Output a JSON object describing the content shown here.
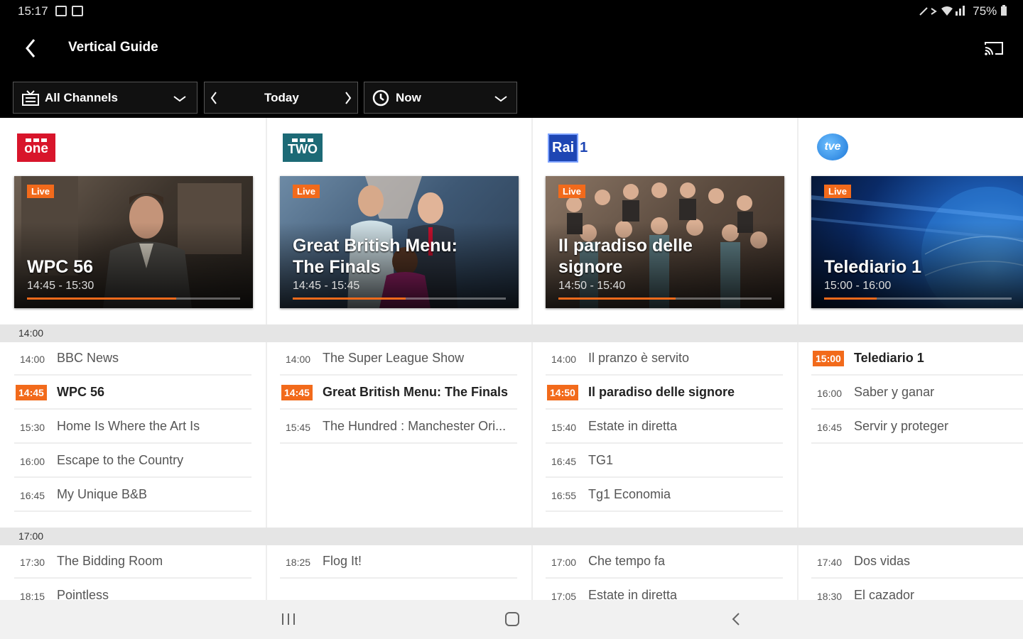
{
  "status_bar": {
    "time": "15:17",
    "battery": "75%"
  },
  "app_bar": {
    "title": "Vertical Guide"
  },
  "filters": {
    "channels": "All Channels",
    "day": "Today",
    "time": "Now"
  },
  "sections": [
    "14:00",
    "17:00"
  ],
  "columns": [
    {
      "logo": "one",
      "featured": {
        "live": "Live",
        "title_line1": "WPC 56",
        "title_line2": "",
        "time": "14:45 - 15:30",
        "progress": 0.7
      },
      "block1": [
        {
          "time": "14:00",
          "name": "BBC News"
        },
        {
          "time": "14:45",
          "name": "WPC 56"
        },
        {
          "time": "15:30",
          "name": "Home Is Where the Art Is"
        },
        {
          "time": "16:00",
          "name": "Escape to the Country"
        },
        {
          "time": "16:45",
          "name": "My Unique B&B"
        }
      ],
      "block2": [
        {
          "time": "17:30",
          "name": "The Bidding Room"
        },
        {
          "time": "18:15",
          "name": "Pointless"
        }
      ]
    },
    {
      "logo": "TWO",
      "featured": {
        "live": "Live",
        "title_line1": "Great British Menu:",
        "title_line2": "The Finals",
        "time": "14:45 - 15:45",
        "progress": 0.53
      },
      "block1": [
        {
          "time": "14:00",
          "name": "The Super League Show"
        },
        {
          "time": "14:45",
          "name": "Great British Menu: The Finals"
        },
        {
          "time": "15:45",
          "name": "The Hundred : Manchester Ori..."
        }
      ],
      "block2": [
        {
          "time": "18:25",
          "name": "Flog It!"
        }
      ]
    },
    {
      "logo": "Rai",
      "logo_num": "1",
      "featured": {
        "live": "Live",
        "title_line1": "Il paradiso delle",
        "title_line2": "signore",
        "time": "14:50 - 15:40",
        "progress": 0.55
      },
      "block1": [
        {
          "time": "14:00",
          "name": "Il pranzo è servito"
        },
        {
          "time": "14:50",
          "name": "Il paradiso delle signore"
        },
        {
          "time": "15:40",
          "name": "Estate in diretta"
        },
        {
          "time": "16:45",
          "name": "TG1"
        },
        {
          "time": "16:55",
          "name": "Tg1 Economia"
        }
      ],
      "block2": [
        {
          "time": "17:00",
          "name": "Che tempo fa"
        },
        {
          "time": "17:05",
          "name": "Estate in diretta"
        }
      ]
    },
    {
      "logo": "tve",
      "featured": {
        "live": "Live",
        "title_line1": "Telediario 1",
        "title_line2": "",
        "time": "15:00 - 16:00",
        "progress": 0.28
      },
      "block1": [
        {
          "time": "15:00",
          "name": "Telediario 1"
        },
        {
          "time": "16:00",
          "name": "Saber y ganar"
        },
        {
          "time": "16:45",
          "name": "Servir y proteger"
        }
      ],
      "block2": [
        {
          "time": "17:40",
          "name": "Dos vidas"
        },
        {
          "time": "18:30",
          "name": "El cazador"
        }
      ]
    }
  ]
}
